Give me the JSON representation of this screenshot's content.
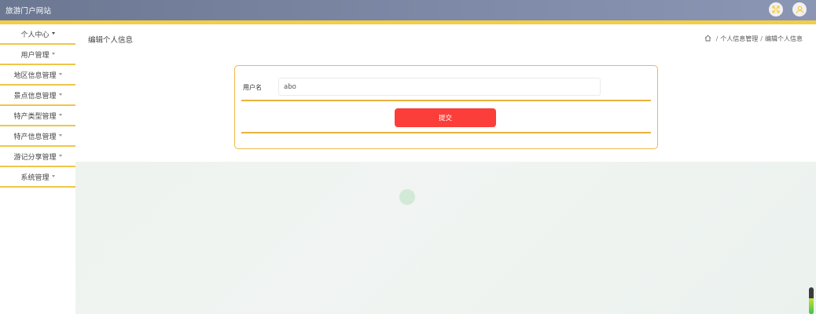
{
  "header": {
    "site_title": "旅游门户网站",
    "icons": {
      "fullscreen": "fullscreen-icon",
      "user": "user-avatar-icon"
    },
    "accent_color": "#f4cd46"
  },
  "sidebar": {
    "items": [
      {
        "label": "个人中心"
      },
      {
        "label": "用户管理"
      },
      {
        "label": "地区信息管理"
      },
      {
        "label": "景点信息管理"
      },
      {
        "label": "特产类型管理"
      },
      {
        "label": "特产信息管理"
      },
      {
        "label": "游记分享管理"
      },
      {
        "label": "系统管理"
      }
    ],
    "divider_color": "#f0c64a"
  },
  "main": {
    "heading": "编辑个人信息",
    "breadcrumb": [
      "个人信息管理",
      "编辑个人信息"
    ],
    "breadcrumb_separator": "/",
    "form": {
      "username_label": "用户名",
      "username_value": "abo",
      "submit_label": "提交",
      "submit_color": "#fb3e3a",
      "border_color": "#f0b84a"
    }
  },
  "scroll_indicator": {
    "level": 0.6
  }
}
